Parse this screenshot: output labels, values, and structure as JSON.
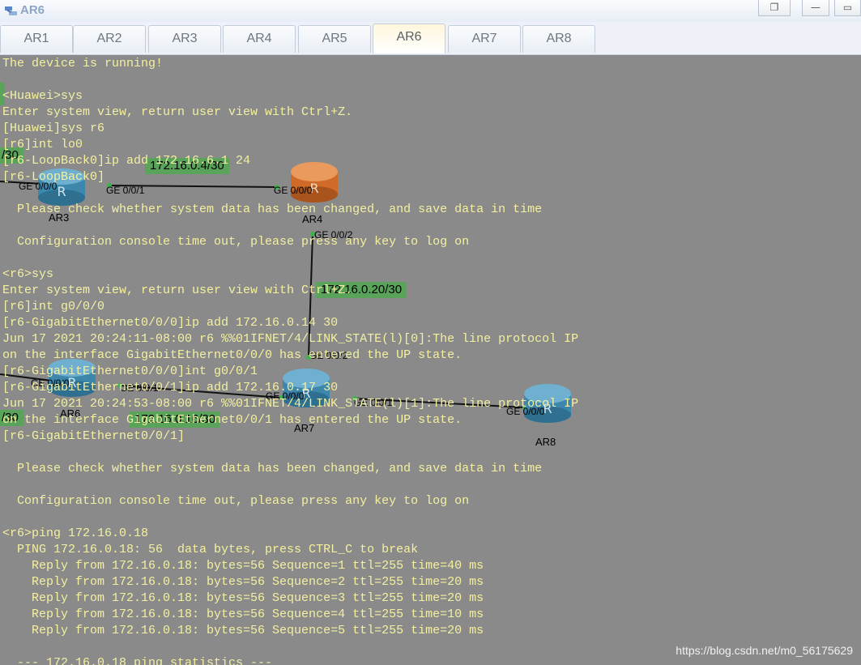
{
  "window": {
    "title": "AR6",
    "icon": "router-app-icon",
    "restore_glyph": "❐",
    "minimize_glyph": "—",
    "maximize_glyph": "▭"
  },
  "tabs": [
    {
      "label": "AR1"
    },
    {
      "label": "AR2"
    },
    {
      "label": "AR3"
    },
    {
      "label": "AR4"
    },
    {
      "label": "AR5"
    },
    {
      "label": "AR6",
      "active": true
    },
    {
      "label": "AR7"
    },
    {
      "label": "AR8"
    }
  ],
  "topology": {
    "devices": {
      "ar3": "AR3",
      "ar4": "AR4",
      "ar6": "AR6",
      "ar7": "AR7",
      "ar8": "AR8"
    },
    "ports": {
      "ar3_ge000": "GE 0/0/0",
      "ar3_ge001": "GE 0/0/1",
      "ar4_ge000": "GE 0/0/0",
      "ar4_ge002": "GE 0/0/2",
      "ar7_ge002": "GE 0/0/2",
      "ar7_ge000": "GE 0/0/0",
      "ar7_ge001": "GE 0/0/1",
      "ar6_ge000": "GE 0/0/0",
      "ar6_ge001": "GE 0/0/1",
      "ar8_ge000": "GE 0/0/0"
    },
    "subnets": {
      "left_top": "/30",
      "ar3_ar4": "172.16.0.4/30",
      "ar4_ar7": "172.16.0.20/30",
      "ar6_ar7": "172.16.0.16/30",
      "left_bottom": "/30"
    },
    "colors": {
      "router_blue": "#3d87ad",
      "router_orange": "#cf6a28",
      "link": "#111111",
      "subnet_bg": "#5aa35a",
      "port_dot": "#3bb54a"
    }
  },
  "terminal": {
    "text_color": "#f4f0a0",
    "lines": [
      "The device is running!",
      "",
      "<Huawei>sys",
      "Enter system view, return user view with Ctrl+Z.",
      "[Huawei]sys r6",
      "[r6]int lo0",
      "[r6-LoopBack0]ip add 172.16.6.1 24",
      "[r6-LoopBack0]",
      "",
      "  Please check whether system data has been changed, and save data in time",
      "",
      "  Configuration console time out, please press any key to log on",
      "",
      "<r6>sys",
      "Enter system view, return user view with Ctrl+Z.",
      "[r6]int g0/0/0",
      "[r6-GigabitEthernet0/0/0]ip add 172.16.0.14 30",
      "Jun 17 2021 20:24:11-08:00 r6 %%01IFNET/4/LINK_STATE(l)[0]:The line protocol IP",
      "on the interface GigabitEthernet0/0/0 has entered the UP state.",
      "[r6-GigabitEthernet0/0/0]int g0/0/1",
      "[r6-GigabitEthernet0/0/1]ip add 172.16.0.17 30",
      "Jun 17 2021 20:24:53-08:00 r6 %%01IFNET/4/LINK_STATE(l)[1]:The line protocol IP",
      "on the interface GigabitEthernet0/0/1 has entered the UP state.",
      "[r6-GigabitEthernet0/0/1]",
      "",
      "  Please check whether system data has been changed, and save data in time",
      "",
      "  Configuration console time out, please press any key to log on",
      "",
      "<r6>ping 172.16.0.18",
      "  PING 172.16.0.18: 56  data bytes, press CTRL_C to break",
      "    Reply from 172.16.0.18: bytes=56 Sequence=1 ttl=255 time=40 ms",
      "    Reply from 172.16.0.18: bytes=56 Sequence=2 ttl=255 time=20 ms",
      "    Reply from 172.16.0.18: bytes=56 Sequence=3 ttl=255 time=20 ms",
      "    Reply from 172.16.0.18: bytes=56 Sequence=4 ttl=255 time=10 ms",
      "    Reply from 172.16.0.18: bytes=56 Sequence=5 ttl=255 time=20 ms",
      "",
      "  --- 172.16.0.18 ping statistics ---"
    ]
  },
  "watermark": "https://blog.csdn.net/m0_56175629"
}
